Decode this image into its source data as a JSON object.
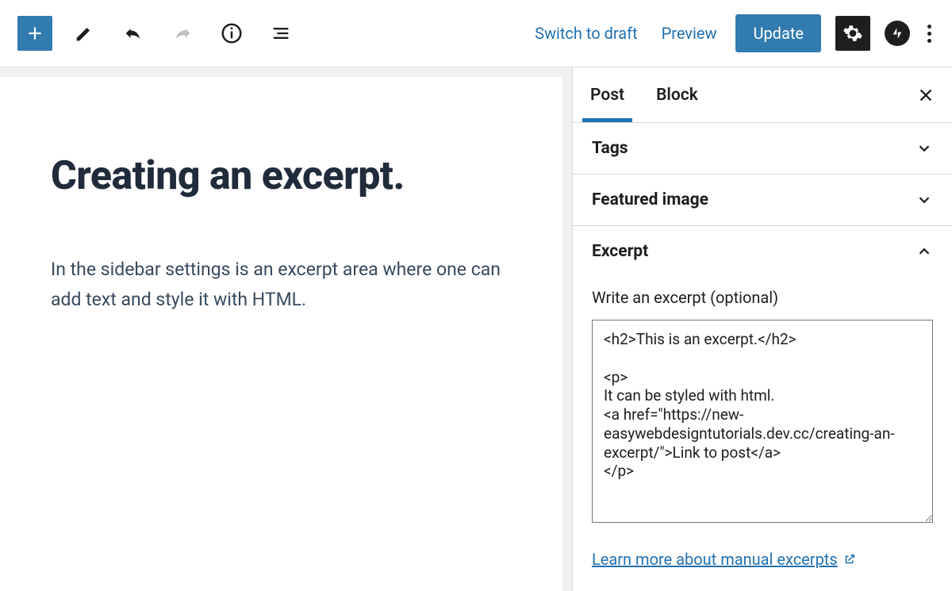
{
  "toolbar": {
    "switch_to_draft": "Switch to draft",
    "preview": "Preview",
    "update": "Update"
  },
  "editor": {
    "title": "Creating an excerpt.",
    "body": "In the sidebar settings is an excerpt area where one can add  text and style it with HTML."
  },
  "sidebar": {
    "tabs": {
      "post": "Post",
      "block": "Block"
    },
    "panels": {
      "tags": "Tags",
      "featured_image": "Featured image",
      "excerpt": "Excerpt"
    },
    "excerpt": {
      "label": "Write an excerpt (optional)",
      "value": "<h2>This is an excerpt.</h2>\n\n<p>\nIt can be styled with html.\n<a href=\"https://new-easywebdesigntutorials.dev.cc/creating-an-excerpt/\">Link to post</a>\n</p>",
      "learn_more": "Learn more about manual excerpts"
    }
  },
  "colors": {
    "accent": "#2271b1",
    "button": "#327bb0"
  }
}
